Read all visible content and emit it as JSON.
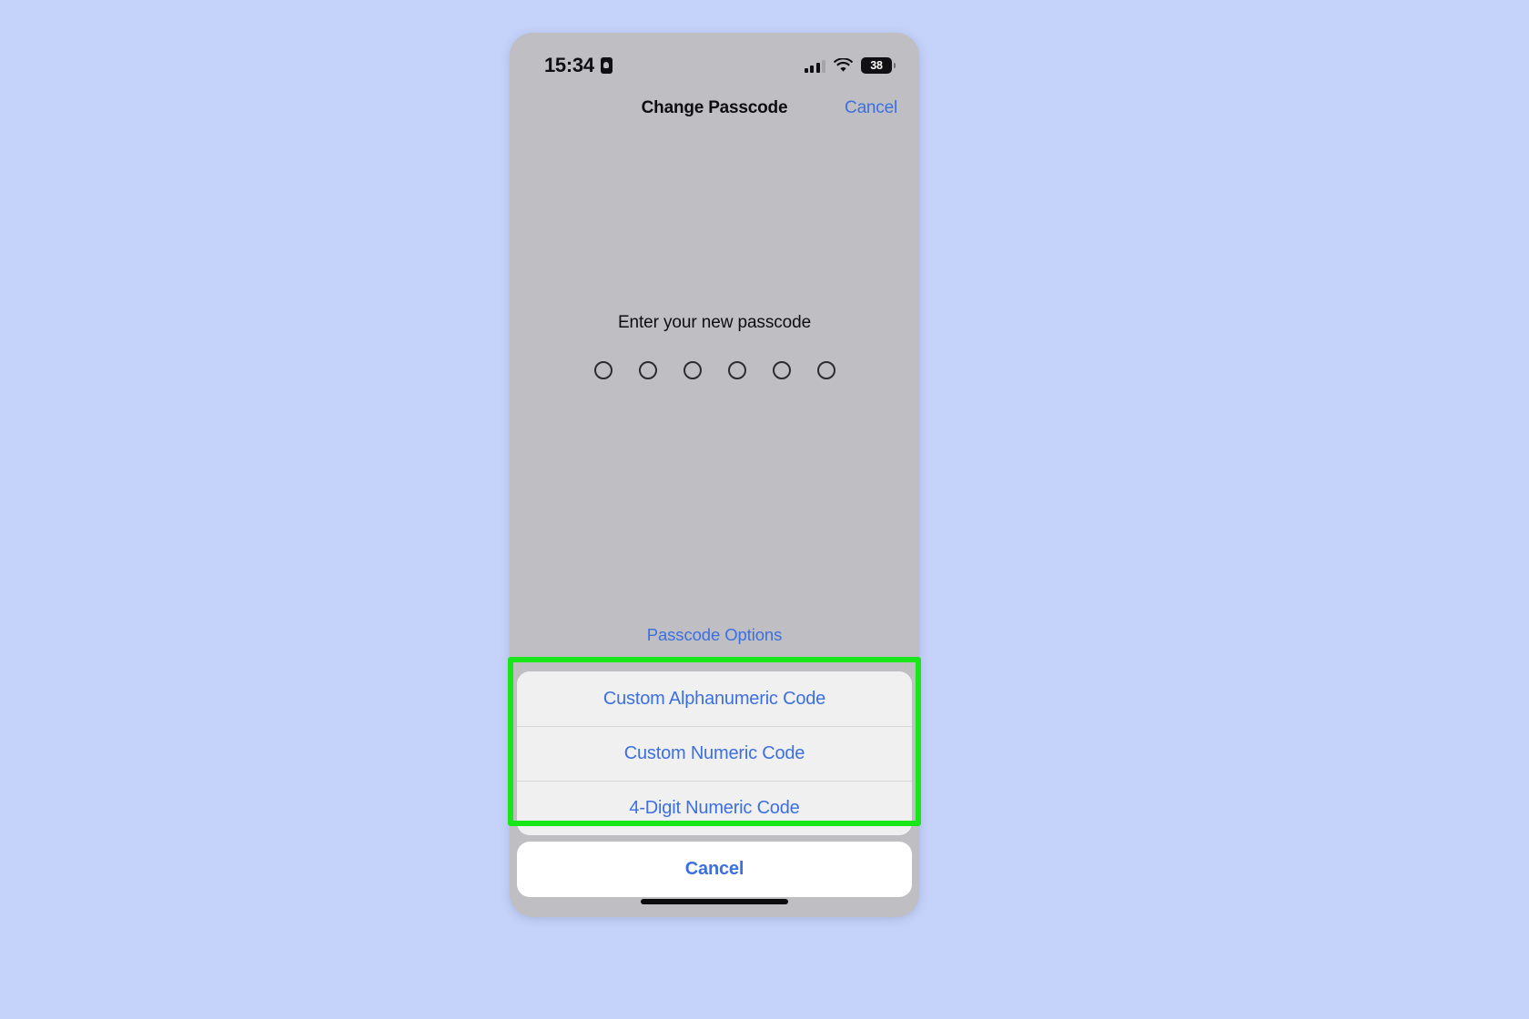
{
  "theme": {
    "page_background": "#c5d2f9",
    "screen_dim": "#bebec3",
    "accent_blue": "#3c6fe0",
    "sheet_fill": "#f0f0f0",
    "cancel_fill": "#ffffff",
    "highlight_green": "#19e619"
  },
  "status_bar": {
    "time": "15:34",
    "lock_icon": "lock-portrait-orientation-icon",
    "cellular_icon": "cellular-bars-icon",
    "wifi_icon": "wifi-icon",
    "battery_icon": "battery-icon",
    "battery_level": "38"
  },
  "nav_bar": {
    "title": "Change Passcode",
    "cancel_label": "Cancel"
  },
  "passcode": {
    "prompt": "Enter your new passcode",
    "dot_count": 6,
    "dots_filled": 0,
    "options_link": "Passcode Options"
  },
  "action_sheet": {
    "options": [
      {
        "label": "Custom Alphanumeric Code",
        "name": "custom-alphanumeric-code-button"
      },
      {
        "label": "Custom Numeric Code",
        "name": "custom-numeric-code-button"
      },
      {
        "label": "4-Digit Numeric Code",
        "name": "four-digit-numeric-code-button"
      }
    ],
    "cancel_label": "Cancel"
  },
  "annotation": {
    "type": "highlight-rectangle",
    "color": "#19e619",
    "target": "action-sheet-options-group"
  }
}
